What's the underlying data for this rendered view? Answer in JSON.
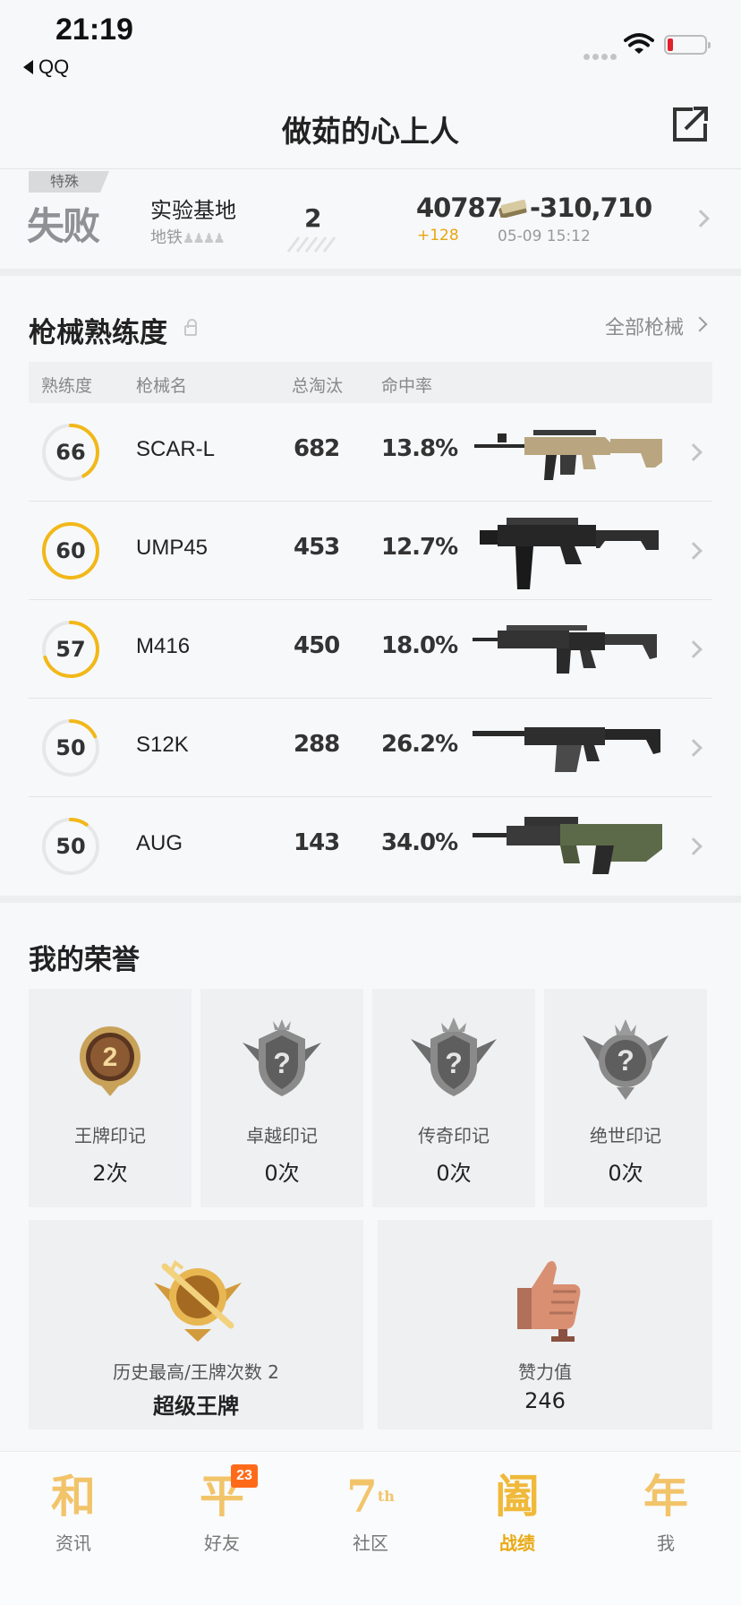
{
  "status_bar": {
    "time": "21:19",
    "back_app": "QQ"
  },
  "header": {
    "title": "做茹的心上人",
    "share_icon": "share-external-icon"
  },
  "match": {
    "tag": "特殊",
    "result": "失败",
    "map": "实验基地",
    "mode": "地铁",
    "mode_icon": "four-person-squad-icon",
    "rank": "2",
    "score": "40787",
    "score_delta": "+128",
    "money": "-310,710",
    "money_icon": "cash-bundle-icon",
    "time": "05-09 15:12",
    "colors": {
      "delta": "#e8a511",
      "result": "#8e9196"
    }
  },
  "weapons": {
    "title": "枪械熟练度",
    "all_link": "全部枪械",
    "columns": [
      "熟练度",
      "枪械名",
      "总淘汰",
      "命中率"
    ],
    "rows": [
      {
        "level": "66",
        "progress": 0.42,
        "name": "SCAR-L",
        "kills": "682",
        "hit_rate": "13.8%"
      },
      {
        "level": "60",
        "progress": 1.0,
        "name": "UMP45",
        "kills": "453",
        "hit_rate": "12.7%"
      },
      {
        "level": "57",
        "progress": 0.7,
        "name": "M416",
        "kills": "450",
        "hit_rate": "18.0%"
      },
      {
        "level": "50",
        "progress": 0.18,
        "name": "S12K",
        "kills": "288",
        "hit_rate": "26.2%"
      },
      {
        "level": "50",
        "progress": 0.1,
        "name": "AUG",
        "kills": "143",
        "hit_rate": "34.0%"
      }
    ],
    "ring_color": "#f2b818"
  },
  "honor": {
    "title": "我的荣誉",
    "medals": [
      {
        "label": "王牌印记",
        "count": "2次",
        "icon": "ace-badge-icon"
      },
      {
        "label": "卓越印记",
        "count": "0次",
        "icon": "locked-elite-badge-icon"
      },
      {
        "label": "传奇印记",
        "count": "0次",
        "icon": "locked-legend-badge-icon"
      },
      {
        "label": "绝世印记",
        "count": "0次",
        "icon": "locked-peerless-badge-icon"
      }
    ],
    "highest": {
      "label": "历史最高/王牌次数 2",
      "value": "超级王牌",
      "icon": "super-ace-emblem-icon"
    },
    "likes": {
      "label": "赞力值",
      "value": "246",
      "icon": "thumbs-up-trophy-icon"
    }
  },
  "tabs": [
    {
      "glyph": "和",
      "label": "资讯"
    },
    {
      "glyph": "平",
      "label": "好友",
      "badge": "23"
    },
    {
      "glyph": "7",
      "sup": "th",
      "label": "社区"
    },
    {
      "glyph": "阖",
      "label": "战绩",
      "active": true
    },
    {
      "glyph": "年",
      "label": "我"
    }
  ]
}
